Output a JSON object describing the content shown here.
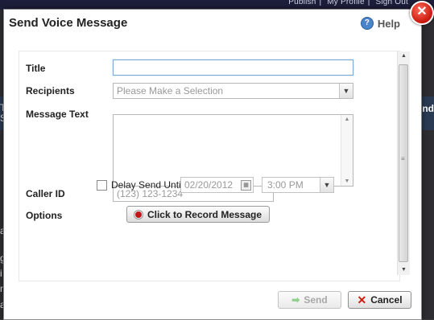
{
  "background": {
    "links": [
      "Publish",
      "My Profile",
      "Sign Out"
    ],
    "right_text": "nd",
    "left_fragments": [
      "T",
      "S",
      "a",
      "g",
      "i",
      "n",
      "o",
      "a"
    ]
  },
  "dialog": {
    "title": "Send Voice Message",
    "help_label": "Help",
    "close_symbol": "✕"
  },
  "form": {
    "title_label": "Title",
    "title_value": "",
    "recipients_label": "Recipients",
    "recipients_selected": "Please Make a Selection",
    "message_text_label": "Message Text",
    "message_text_value": "",
    "caller_id_label": "Caller ID",
    "caller_id_placeholder": "(123) 123-1234",
    "options_label": "Options",
    "delay_send_label": "Delay Send Until",
    "delay_send_checked": false,
    "delay_date": "02/20/2012",
    "delay_time": "3:00 PM",
    "record_button_label": "Click to Record Message"
  },
  "footer": {
    "send_label": "Send",
    "cancel_label": "Cancel"
  }
}
